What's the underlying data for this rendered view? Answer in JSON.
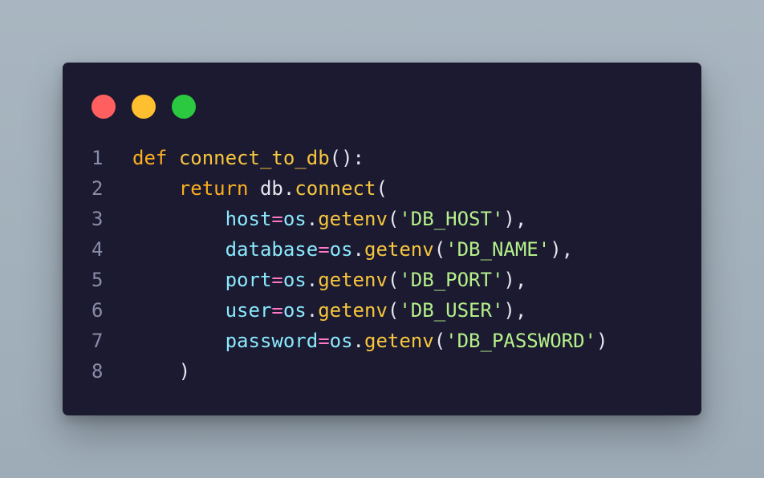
{
  "colors": {
    "red": "#ff5f5f",
    "yellow": "#fec02f",
    "green": "#2ac940",
    "keyword": "#fcae20",
    "function": "#f7c63e",
    "param": "#8be9fd",
    "string": "#b5f08a",
    "operator": "#ff79c6",
    "punct": "#e6e6ee",
    "linenum": "#8a8ca8"
  },
  "window_controls": [
    {
      "name": "close",
      "color": "#ff5f5f"
    },
    {
      "name": "minimize",
      "color": "#fec02f"
    },
    {
      "name": "maximize",
      "color": "#2ac940"
    }
  ],
  "code": {
    "lines": [
      {
        "n": "1",
        "tokens": [
          {
            "t": "def",
            "k": "keyword"
          },
          {
            "t": " ",
            "k": "punct"
          },
          {
            "t": "connect_to_db",
            "k": "function"
          },
          {
            "t": "():",
            "k": "punct"
          }
        ]
      },
      {
        "n": "2",
        "tokens": [
          {
            "t": "    ",
            "k": "punct"
          },
          {
            "t": "return",
            "k": "keyword"
          },
          {
            "t": " db.",
            "k": "punct"
          },
          {
            "t": "connect",
            "k": "function"
          },
          {
            "t": "(",
            "k": "punct"
          }
        ]
      },
      {
        "n": "3",
        "tokens": [
          {
            "t": "        ",
            "k": "punct"
          },
          {
            "t": "host",
            "k": "param"
          },
          {
            "t": "=",
            "k": "operator"
          },
          {
            "t": "os",
            "k": "param"
          },
          {
            "t": ".",
            "k": "punct"
          },
          {
            "t": "getenv",
            "k": "function"
          },
          {
            "t": "(",
            "k": "punct"
          },
          {
            "t": "'DB_HOST'",
            "k": "string"
          },
          {
            "t": "),",
            "k": "punct"
          }
        ]
      },
      {
        "n": "4",
        "tokens": [
          {
            "t": "        ",
            "k": "punct"
          },
          {
            "t": "database",
            "k": "param"
          },
          {
            "t": "=",
            "k": "operator"
          },
          {
            "t": "os",
            "k": "param"
          },
          {
            "t": ".",
            "k": "punct"
          },
          {
            "t": "getenv",
            "k": "function"
          },
          {
            "t": "(",
            "k": "punct"
          },
          {
            "t": "'DB_NAME'",
            "k": "string"
          },
          {
            "t": "),",
            "k": "punct"
          }
        ]
      },
      {
        "n": "5",
        "tokens": [
          {
            "t": "        ",
            "k": "punct"
          },
          {
            "t": "port",
            "k": "param"
          },
          {
            "t": "=",
            "k": "operator"
          },
          {
            "t": "os",
            "k": "param"
          },
          {
            "t": ".",
            "k": "punct"
          },
          {
            "t": "getenv",
            "k": "function"
          },
          {
            "t": "(",
            "k": "punct"
          },
          {
            "t": "'DB_PORT'",
            "k": "string"
          },
          {
            "t": "),",
            "k": "punct"
          }
        ]
      },
      {
        "n": "6",
        "tokens": [
          {
            "t": "        ",
            "k": "punct"
          },
          {
            "t": "user",
            "k": "param"
          },
          {
            "t": "=",
            "k": "operator"
          },
          {
            "t": "os",
            "k": "param"
          },
          {
            "t": ".",
            "k": "punct"
          },
          {
            "t": "getenv",
            "k": "function"
          },
          {
            "t": "(",
            "k": "punct"
          },
          {
            "t": "'DB_USER'",
            "k": "string"
          },
          {
            "t": "),",
            "k": "punct"
          }
        ]
      },
      {
        "n": "7",
        "tokens": [
          {
            "t": "        ",
            "k": "punct"
          },
          {
            "t": "password",
            "k": "param"
          },
          {
            "t": "=",
            "k": "operator"
          },
          {
            "t": "os",
            "k": "param"
          },
          {
            "t": ".",
            "k": "punct"
          },
          {
            "t": "getenv",
            "k": "function"
          },
          {
            "t": "(",
            "k": "punct"
          },
          {
            "t": "'DB_PASSWORD'",
            "k": "string"
          },
          {
            "t": ")",
            "k": "punct"
          }
        ]
      },
      {
        "n": "8",
        "tokens": [
          {
            "t": "    ",
            "k": "punct"
          },
          {
            "t": ")",
            "k": "punct"
          }
        ]
      }
    ]
  }
}
